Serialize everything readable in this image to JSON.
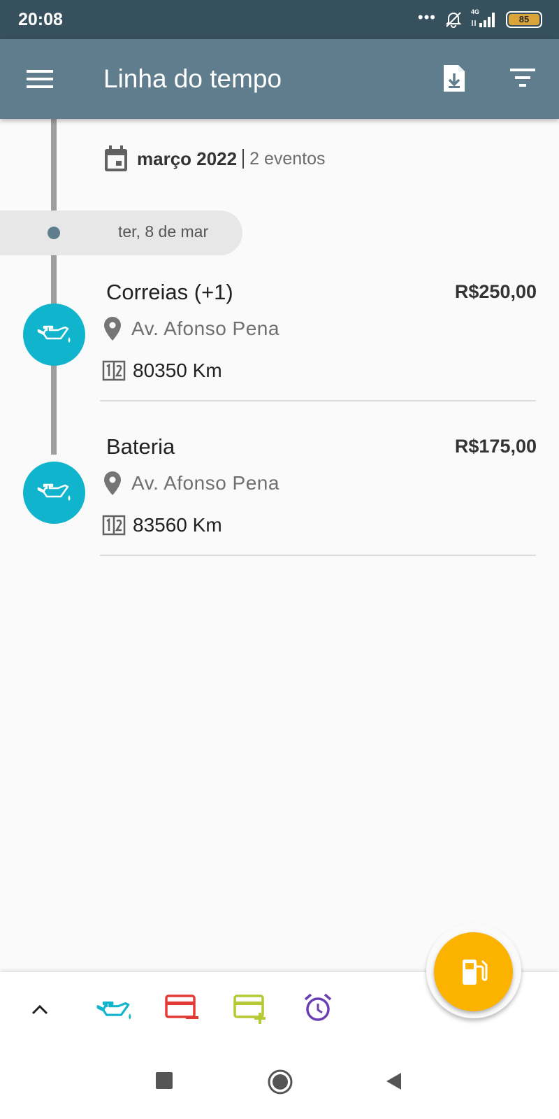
{
  "status_bar": {
    "time": "20:08",
    "dots": "•••",
    "network": "4G",
    "battery": "85"
  },
  "app_bar": {
    "title": "Linha do tempo"
  },
  "timeline": {
    "month": "março 2022",
    "event_count": "2 eventos",
    "day": "ter, 8 de mar",
    "events": [
      {
        "title": "Correias (+1)",
        "price": "R$250,00",
        "location": "Av. Afonso Pena",
        "odometer": "80350 Km",
        "icon": "oil-can-icon"
      },
      {
        "title": "Bateria",
        "price": "R$175,00",
        "location": "Av. Afonso Pena",
        "odometer": "83560 Km",
        "icon": "oil-can-icon"
      }
    ]
  },
  "bottom_bar": {
    "items": [
      "chevron-up-icon",
      "oil-can-icon",
      "expense-card-icon",
      "income-card-icon",
      "alarm-clock-icon"
    ],
    "fab_icon": "fuel-pump-icon"
  },
  "colors": {
    "status_bar": "#37505e",
    "app_bar": "#5f7d8c",
    "event_badge": "#10b4cc",
    "fab": "#fcb300",
    "expense": "#e53935",
    "income": "#b5c934",
    "reminder": "#6a3fb5"
  }
}
